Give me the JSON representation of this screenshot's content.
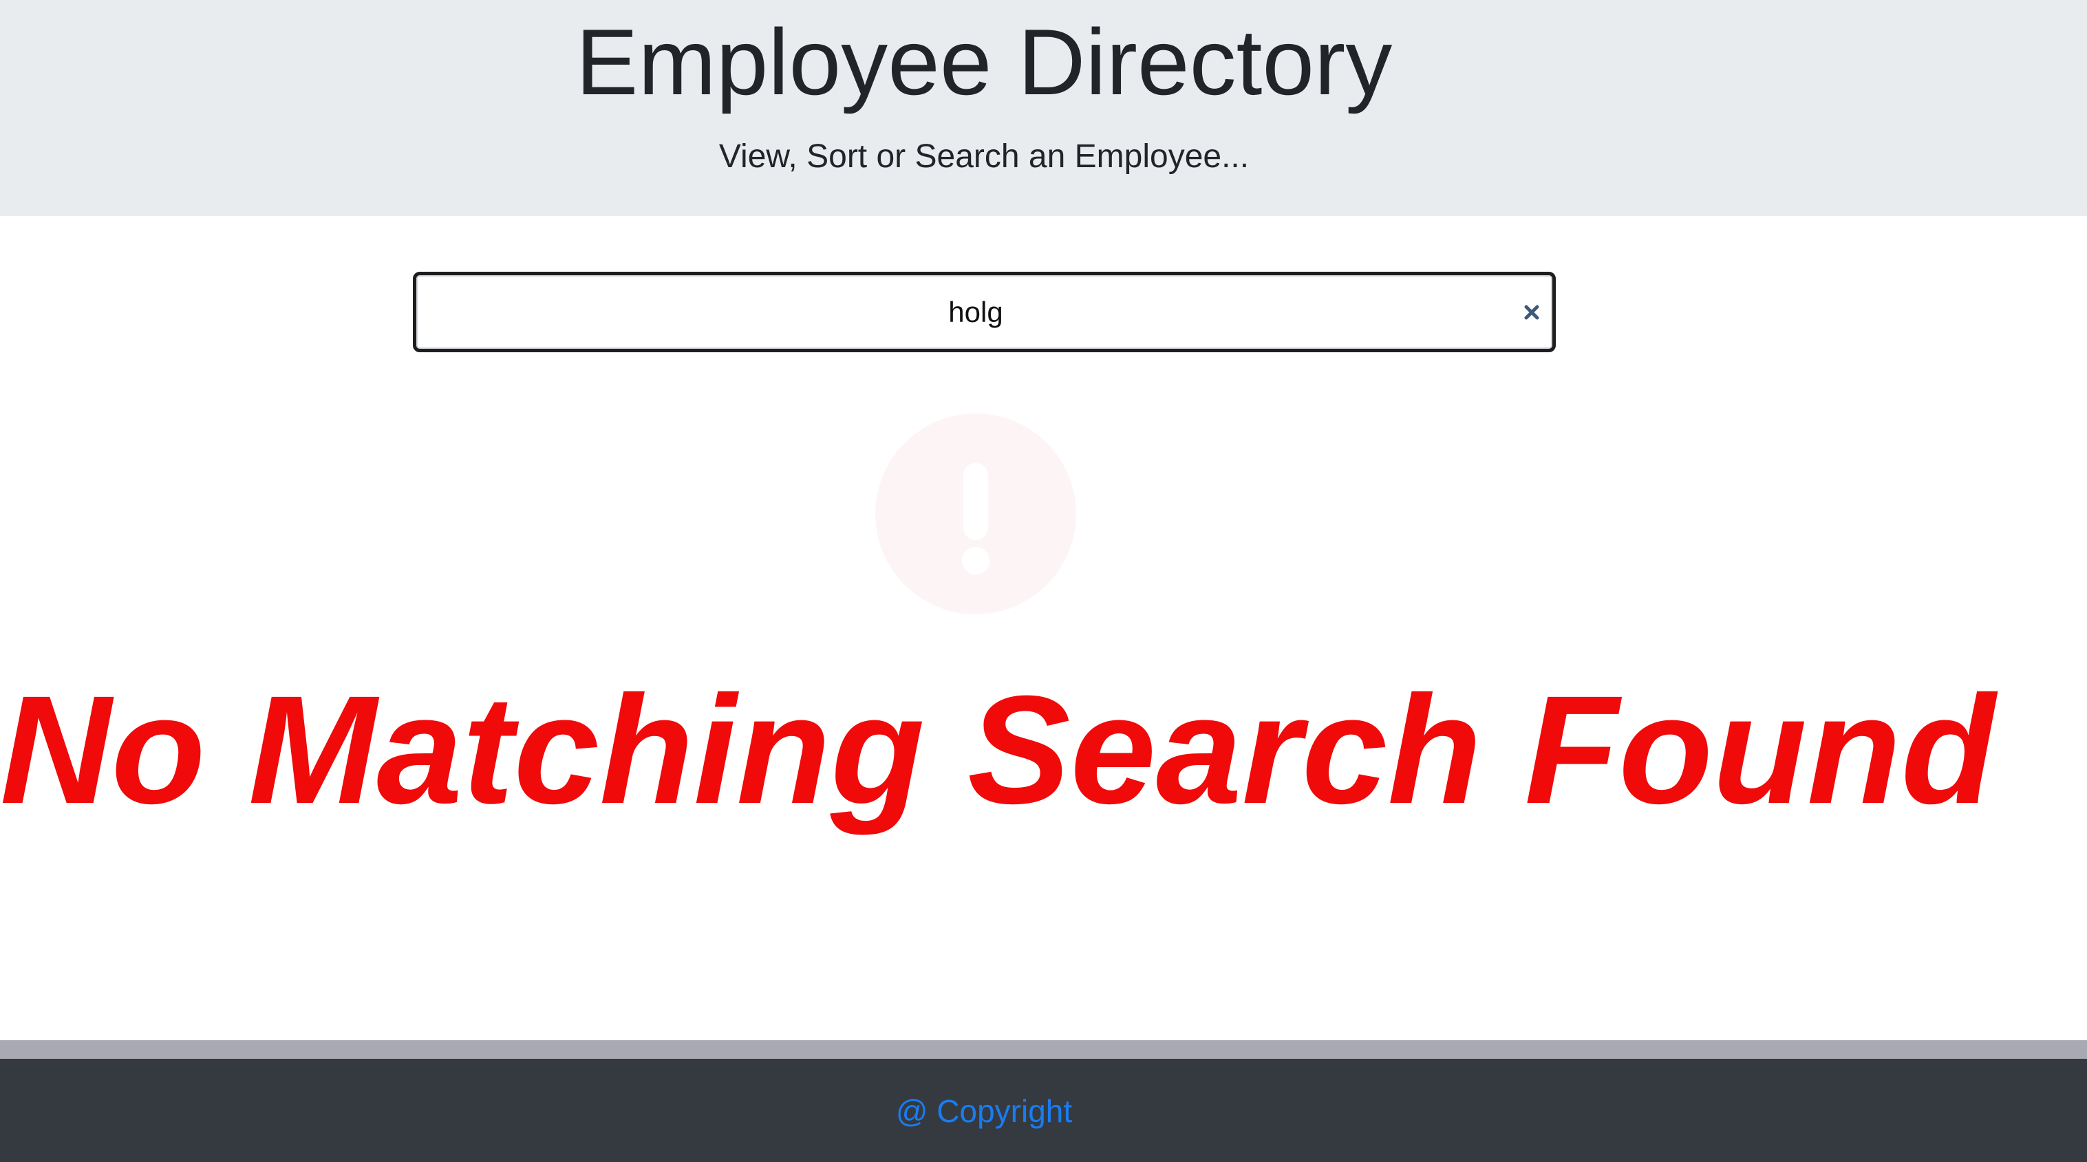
{
  "header": {
    "title": "Employee Directory",
    "subtitle": "View, Sort or Search an Employee..."
  },
  "search": {
    "value": "holg",
    "clear_icon": "close-icon"
  },
  "result": {
    "status_icon": "exclamation-circle-icon",
    "message": "No Matching Search Found"
  },
  "footer": {
    "copyright": "@ Copyright"
  },
  "colors": {
    "header_bg": "#e9ecef",
    "message": "#f00a0a",
    "footer_bg": "#343a40",
    "link": "#1a7cf0"
  }
}
